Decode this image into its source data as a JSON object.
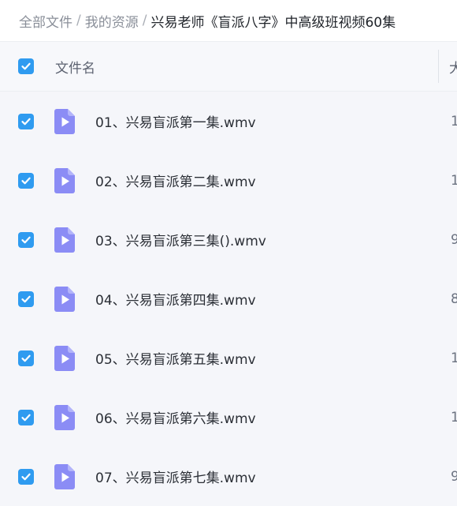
{
  "breadcrumb": {
    "items": [
      "全部文件",
      "我的资源"
    ],
    "separator": "/",
    "current": "兴易老师《盲派八字》中高级班视频60集"
  },
  "header": {
    "name_label": "文件名",
    "size_label": "大",
    "all_checked": true
  },
  "files": [
    {
      "name": "01、兴易盲派第一集.wmv",
      "size_fragment": "1",
      "checked": true,
      "icon": "video-file-icon"
    },
    {
      "name": "02、兴易盲派第二集.wmv",
      "size_fragment": "1",
      "checked": true,
      "icon": "video-file-icon"
    },
    {
      "name": "03、兴易盲派第三集().wmv",
      "size_fragment": "9",
      "checked": true,
      "icon": "video-file-icon"
    },
    {
      "name": "04、兴易盲派第四集.wmv",
      "size_fragment": "8",
      "checked": true,
      "icon": "video-file-icon"
    },
    {
      "name": "05、兴易盲派第五集.wmv",
      "size_fragment": "1",
      "checked": true,
      "icon": "video-file-icon"
    },
    {
      "name": "06、兴易盲派第六集.wmv",
      "size_fragment": "1",
      "checked": true,
      "icon": "video-file-icon"
    },
    {
      "name": "07、兴易盲派第七集.wmv",
      "size_fragment": "9",
      "checked": true,
      "icon": "video-file-icon"
    }
  ],
  "colors": {
    "checkbox": "#2f9bf0",
    "video_icon": "#8b8cf5",
    "background": "#f4f6fb"
  }
}
